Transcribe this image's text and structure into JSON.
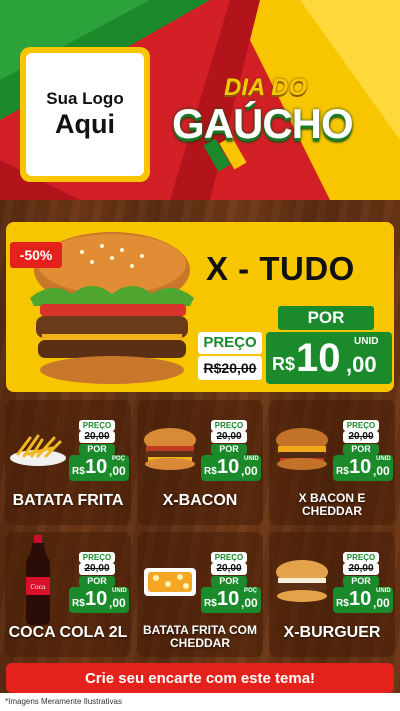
{
  "header": {
    "logo_line1": "Sua Logo",
    "logo_line2": "Aqui",
    "title_line1": "DIA DO",
    "title_line2": "GAÚCHO",
    "colors": {
      "red": "#d31f26",
      "green": "#1a8a2a",
      "yellow": "#f7c600"
    }
  },
  "hero": {
    "name": "X - TUDO",
    "discount": "-50%",
    "price_label": "PREÇO",
    "old_price": "R$20,00",
    "por_label": "POR",
    "unit_label": "UNID",
    "currency": "R$",
    "new_price_int": "10",
    "new_price_dec": ",00"
  },
  "products": [
    {
      "name": "BATATA FRITA",
      "price_label": "PREÇO",
      "old_price": "20,00",
      "por_label": "POR",
      "currency": "R$",
      "price_int": "10",
      "price_dec": ",00",
      "unit_label": "POÇ",
      "icon": "fries-image"
    },
    {
      "name": "X-BACON",
      "price_label": "PREÇO",
      "old_price": "20,00",
      "por_label": "POR",
      "currency": "R$",
      "price_int": "10",
      "price_dec": ",00",
      "unit_label": "UNID",
      "icon": "bacon-burger-image"
    },
    {
      "name": "X BACON E CHEDDAR",
      "price_label": "PREÇO",
      "old_price": "20,00",
      "por_label": "POR",
      "currency": "R$",
      "price_int": "10",
      "price_dec": ",00",
      "unit_label": "UNID",
      "icon": "cheddar-burger-image"
    },
    {
      "name": "COCA COLA 2L",
      "price_label": "PREÇO",
      "old_price": "20,00",
      "por_label": "POR",
      "currency": "R$",
      "price_int": "10",
      "price_dec": ",00",
      "unit_label": "UNID",
      "icon": "soda-bottle-image"
    },
    {
      "name": "BATATA FRITA COM CHEDDAR",
      "price_label": "PREÇO",
      "old_price": "20,00",
      "por_label": "POR",
      "currency": "R$",
      "price_int": "10",
      "price_dec": ",00",
      "unit_label": "POÇ",
      "icon": "cheddar-fries-image"
    },
    {
      "name": "X-BURGUER",
      "price_label": "PREÇO",
      "old_price": "20,00",
      "por_label": "POR",
      "currency": "R$",
      "price_int": "10",
      "price_dec": ",00",
      "unit_label": "UNID",
      "icon": "burger-image"
    }
  ],
  "cta": "Crie seu encarte com este tema!",
  "footer_note": "*Imagens Meramente Ilustrativas"
}
